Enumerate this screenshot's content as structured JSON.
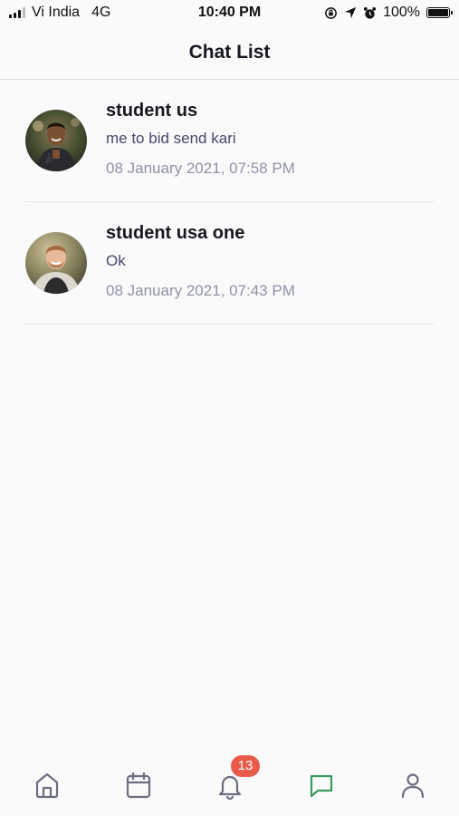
{
  "status_bar": {
    "carrier": "Vi India",
    "network": "4G",
    "time": "10:40 PM",
    "battery": "100%",
    "icons": [
      "signal-icon",
      "screen-rotation-lock-icon",
      "location-arrow-icon",
      "alarm-icon",
      "battery-icon"
    ]
  },
  "header": {
    "title": "Chat List"
  },
  "chats": [
    {
      "name": "student us",
      "message": "me to bid send kari",
      "time": "08 January 2021, 07:58 PM"
    },
    {
      "name": "student usa one",
      "message": "Ok",
      "time": "08 January 2021, 07:43 PM"
    }
  ],
  "tab_bar": {
    "items": [
      {
        "icon": "home-icon"
      },
      {
        "icon": "calendar-icon"
      },
      {
        "icon": "bell-icon",
        "badge": "13"
      },
      {
        "icon": "chat-icon",
        "active": true
      },
      {
        "icon": "profile-icon"
      }
    ],
    "active_color": "#3c9a5f",
    "inactive_color": "#6b6e80",
    "badge_color": "#e85a4a"
  }
}
